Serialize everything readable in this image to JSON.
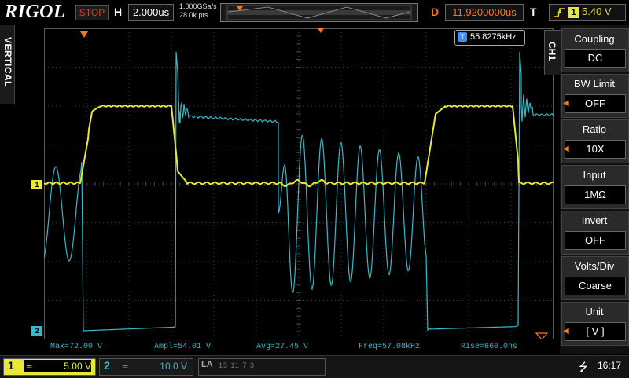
{
  "header": {
    "brand": "RIGOL",
    "run_state": "STOP",
    "h_label": "H",
    "timebase": "2.000us",
    "sample_rate": "1.000GSa/s",
    "mem_depth": "28.0k pts",
    "d_label": "D",
    "delay": "11.9200000us",
    "t_label": "T",
    "trigger_channel": "1",
    "trigger_level": "5.40 V"
  },
  "left_tab": {
    "label": "VERTICAL"
  },
  "plot": {
    "freq_counter_icon": "T",
    "freq_counter": "55.8275kHz",
    "ch1_marker": "1",
    "ch2_marker": "2"
  },
  "measurements": [
    "Max=72.00 V",
    "Ampl=54.01 V",
    "Avg=27.45 V",
    "Freq=57.08kHz",
    "Rise=660.0ns"
  ],
  "menu": {
    "tab_label": "CH1",
    "items": [
      {
        "title": "Coupling",
        "value": "DC"
      },
      {
        "title": "BW Limit",
        "value": "OFF"
      },
      {
        "title": "Ratio",
        "value": "10X"
      },
      {
        "title": "Input",
        "value": "1MΩ"
      },
      {
        "title": "Invert",
        "value": "OFF"
      },
      {
        "title": "Volts/Div",
        "value": "Coarse"
      },
      {
        "title": "Unit",
        "value": "[  V  ]"
      }
    ]
  },
  "footer": {
    "ch1_num": "1",
    "ch1_scale": "5.00 V",
    "ch2_num": "2",
    "ch2_scale": "10.0 V",
    "la_label": "LA",
    "la_ticks": "15   11   7   3",
    "time": "16:17"
  },
  "colors": {
    "ch1": "#e8e83a",
    "ch2": "#3ab8c8",
    "grid": "#444444",
    "trigger": "#f07a20"
  },
  "icons": {
    "usb": "usb-icon",
    "trigger_edge": "rising-edge-icon"
  }
}
